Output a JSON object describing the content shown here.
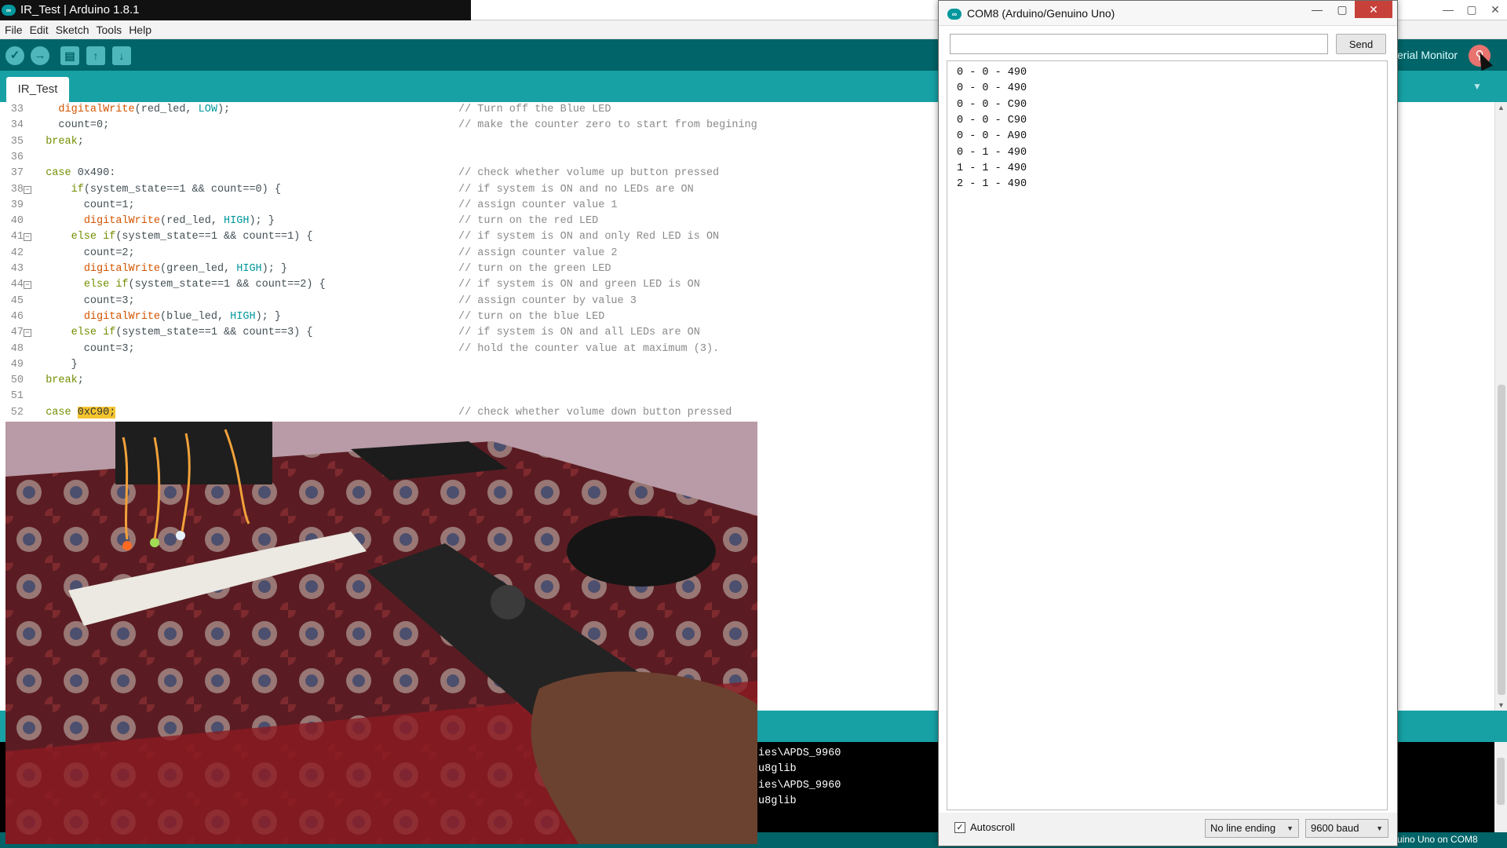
{
  "ide": {
    "title": "IR_Test | Arduino 1.8.1",
    "menu": [
      "File",
      "Edit",
      "Sketch",
      "Tools",
      "Help"
    ],
    "toolbar": {
      "verify_icon": "✓",
      "upload_icon": "→",
      "new_icon": "▤",
      "open_icon": "↑",
      "save_icon": "↓",
      "serial_monitor_label": "erial Monitor",
      "serial_monitor_icon": "⚲"
    },
    "tab_name": "IR_Test",
    "window_buttons": [
      "—",
      "▢",
      "✕"
    ]
  },
  "code_lines": [
    {
      "n": "33",
      "code": "    digitalWrite(red_led, LOW);",
      "comment": "// Turn off the Blue LED"
    },
    {
      "n": "34",
      "code": "    count=0;",
      "comment": "// make the counter zero to start from begining"
    },
    {
      "n": "35",
      "code": "  break;",
      "comment": ""
    },
    {
      "n": "36",
      "code": "",
      "comment": ""
    },
    {
      "n": "37",
      "code": "  case 0x490:",
      "comment": "// check whether volume up button pressed"
    },
    {
      "n": "38",
      "code": "      if(system_state==1 && count==0) {",
      "comment": "// if system is ON and no LEDs are ON"
    },
    {
      "n": "39",
      "code": "        count=1;",
      "comment": "// assign counter value 1"
    },
    {
      "n": "40",
      "code": "        digitalWrite(red_led, HIGH); }",
      "comment": "// turn on the red LED"
    },
    {
      "n": "41",
      "code": "      else if(system_state==1 && count==1) {",
      "comment": "// if system is ON and only Red LED is ON"
    },
    {
      "n": "42",
      "code": "        count=2;",
      "comment": "// assign counter value 2"
    },
    {
      "n": "43",
      "code": "        digitalWrite(green_led, HIGH); }",
      "comment": "// turn on the green LED"
    },
    {
      "n": "44",
      "code": "        else if(system_state==1 && count==2) {",
      "comment": "// if system is ON and green LED is ON"
    },
    {
      "n": "45",
      "code": "        count=3;",
      "comment": "// assign counter by value 3"
    },
    {
      "n": "46",
      "code": "        digitalWrite(blue_led, HIGH); }",
      "comment": "// turn on the blue LED"
    },
    {
      "n": "47",
      "code": "      else if(system_state==1 && count==3) {",
      "comment": "// if system is ON and all LEDs are ON"
    },
    {
      "n": "48",
      "code": "        count=3;",
      "comment": "// hold the counter value at maximum (3)."
    },
    {
      "n": "49",
      "code": "      }",
      "comment": ""
    },
    {
      "n": "50",
      "code": "  break;",
      "comment": ""
    },
    {
      "n": "51",
      "code": "",
      "comment": ""
    },
    {
      "n": "52",
      "code": "  case ",
      "highlight": "0xC90;",
      "comment": "// check whether volume down button pressed"
    }
  ],
  "console_lines": [
    "ies\\APDS_9960",
    "u8glib",
    "ies\\APDS_9960",
    "u8glib"
  ],
  "status_text": "uino Uno on COM8",
  "serial_monitor": {
    "title": "COM8 (Arduino/Genuino Uno)",
    "input_value": "",
    "send_label": "Send",
    "output_lines": [
      "0 - 0 - 490",
      "0 - 0 - 490",
      "0 - 0 - C90",
      "0 - 0 - C90",
      "0 - 0 - A90",
      "0 - 1 - 490",
      "1 - 1 - 490",
      "2 - 1 - 490"
    ],
    "autoscroll_label": "Autoscroll",
    "autoscroll_checked": true,
    "line_ending": "No line ending",
    "baud_rate": "9600 baud",
    "window_buttons": [
      "—",
      "▢",
      "✕"
    ]
  },
  "colors": {
    "arduino_teal": "#00979d",
    "toolbar_dark": "#006468",
    "tab_bar": "#17a1a5",
    "highlight": "#f4c430"
  }
}
